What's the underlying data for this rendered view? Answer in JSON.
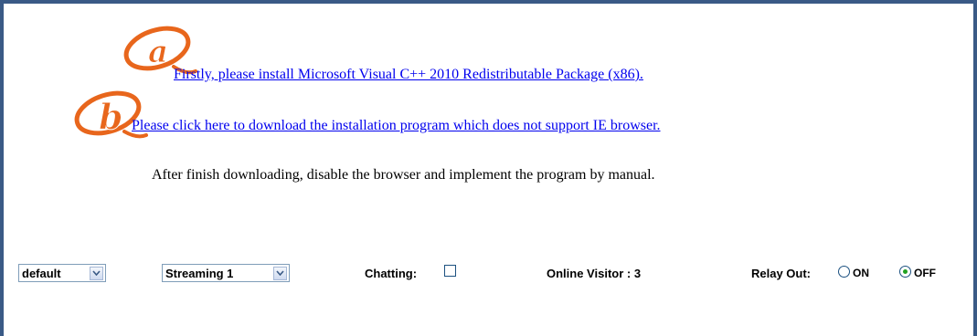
{
  "links": {
    "install_vc": "Firstly, please install Microsoft Visual C++ 2010 Redistributable Package (x86).",
    "download_program": "Please click here to download the installation program which does not support IE browser."
  },
  "markers": {
    "a": "a",
    "b": "b"
  },
  "instructions": "After finish downloading, disable the browser and implement the program by manual.",
  "controls": {
    "quality_select": {
      "selected": "default"
    },
    "stream_select": {
      "selected": "Streaming 1"
    },
    "chatting": {
      "label": "Chatting:",
      "checked": false
    },
    "online_visitor": {
      "label": "Online Visitor : 3"
    },
    "relay_out": {
      "label": "Relay Out:",
      "options": [
        "ON",
        "OFF"
      ],
      "selected": "OFF"
    }
  },
  "colors": {
    "frame": "#3a5a86",
    "link": "#0000ee",
    "marker": "#e8661c"
  }
}
